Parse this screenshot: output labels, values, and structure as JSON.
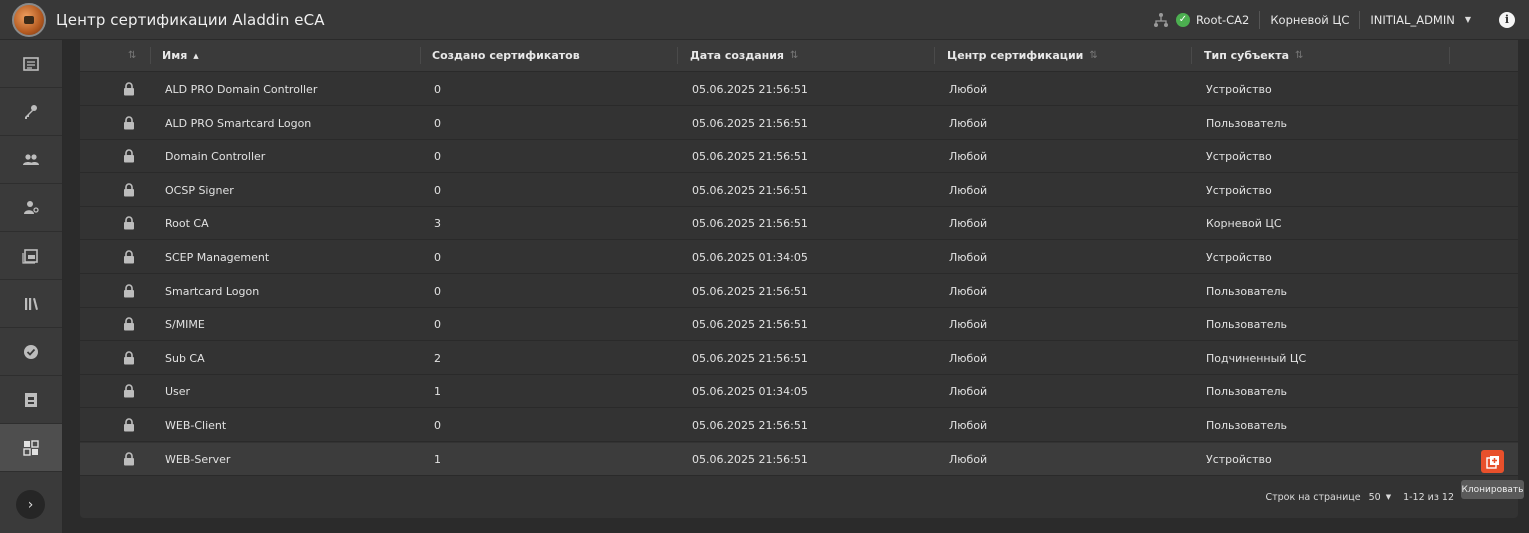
{
  "app": {
    "title": "Центр сертификации Aladdin eCA"
  },
  "topbar": {
    "ca_name": "Root-CA2",
    "role": "Корневой ЦС",
    "user": "INITIAL_ADMIN"
  },
  "table": {
    "columns": [
      {
        "label": ""
      },
      {
        "label": "Имя"
      },
      {
        "label": "Создано сертификатов"
      },
      {
        "label": "Дата создания"
      },
      {
        "label": "Центр сертификации"
      },
      {
        "label": "Тип субъекта"
      }
    ],
    "rows": [
      {
        "name": "ALD PRO Domain Controller",
        "count": "0",
        "date": "05.06.2025 21:56:51",
        "ca": "Любой",
        "subject": "Устройство"
      },
      {
        "name": "ALD PRO Smartcard Logon",
        "count": "0",
        "date": "05.06.2025 21:56:51",
        "ca": "Любой",
        "subject": "Пользователь"
      },
      {
        "name": "Domain Controller",
        "count": "0",
        "date": "05.06.2025 21:56:51",
        "ca": "Любой",
        "subject": "Устройство"
      },
      {
        "name": "OCSP Signer",
        "count": "0",
        "date": "05.06.2025 21:56:51",
        "ca": "Любой",
        "subject": "Устройство"
      },
      {
        "name": "Root CA",
        "count": "3",
        "date": "05.06.2025 21:56:51",
        "ca": "Любой",
        "subject": "Корневой ЦС"
      },
      {
        "name": "SCEP Management",
        "count": "0",
        "date": "05.06.2025 01:34:05",
        "ca": "Любой",
        "subject": "Устройство"
      },
      {
        "name": "Smartcard Logon",
        "count": "0",
        "date": "05.06.2025 21:56:51",
        "ca": "Любой",
        "subject": "Пользователь"
      },
      {
        "name": "S/MIME",
        "count": "0",
        "date": "05.06.2025 21:56:51",
        "ca": "Любой",
        "subject": "Пользователь"
      },
      {
        "name": "Sub CA",
        "count": "2",
        "date": "05.06.2025 21:56:51",
        "ca": "Любой",
        "subject": "Подчиненный ЦС"
      },
      {
        "name": "User",
        "count": "1",
        "date": "05.06.2025 01:34:05",
        "ca": "Любой",
        "subject": "Пользователь"
      },
      {
        "name": "WEB-Client",
        "count": "0",
        "date": "05.06.2025 21:56:51",
        "ca": "Любой",
        "subject": "Пользователь"
      },
      {
        "name": "WEB-Server",
        "count": "1",
        "date": "05.06.2025 21:56:51",
        "ca": "Любой",
        "subject": "Устройство"
      }
    ]
  },
  "row_action": {
    "tooltip": "Клонировать"
  },
  "pagination": {
    "rows_per_page_label": "Строк на странице",
    "rows_per_page_value": "50",
    "range": "1-12 из 12"
  },
  "sidebar": {
    "items": [
      {
        "icon": "dashboard-icon"
      },
      {
        "icon": "key-icon"
      },
      {
        "icon": "users-icon"
      },
      {
        "icon": "user-key-icon"
      },
      {
        "icon": "certificate-icon"
      },
      {
        "icon": "library-icon"
      },
      {
        "icon": "check-badge-icon"
      },
      {
        "icon": "archive-icon"
      },
      {
        "icon": "templates-icon"
      }
    ]
  },
  "colors": {
    "accent": "#e8502b",
    "ok": "#4caf50",
    "background": "#2b2b2b"
  }
}
